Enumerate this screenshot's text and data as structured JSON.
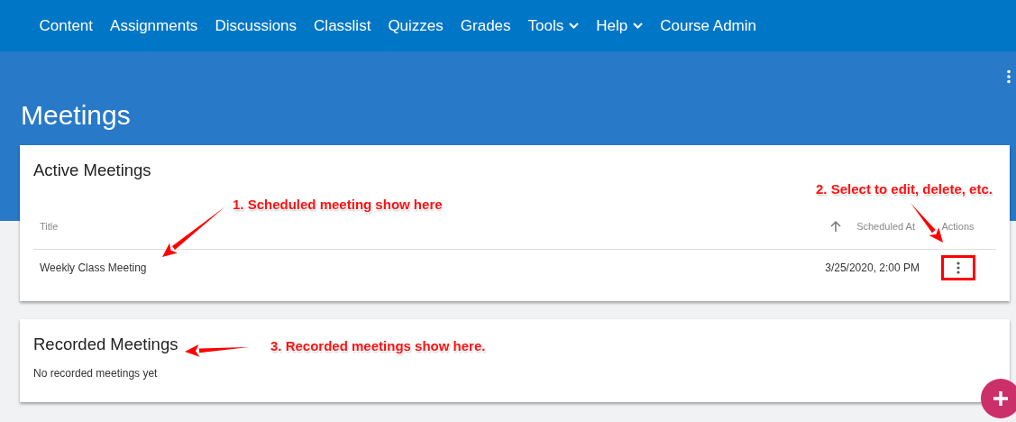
{
  "nav": [
    {
      "label": "Content",
      "has_menu": false
    },
    {
      "label": "Assignments",
      "has_menu": false
    },
    {
      "label": "Discussions",
      "has_menu": false
    },
    {
      "label": "Classlist",
      "has_menu": false
    },
    {
      "label": "Quizzes",
      "has_menu": false
    },
    {
      "label": "Grades",
      "has_menu": false
    },
    {
      "label": "Tools",
      "has_menu": true
    },
    {
      "label": "Help",
      "has_menu": true
    },
    {
      "label": "Course Admin",
      "has_menu": false
    }
  ],
  "page_title": "Meetings",
  "active_meetings": {
    "title": "Active Meetings",
    "columns": [
      {
        "label": "Title",
        "sorted": false
      },
      {
        "label": "Scheduled At",
        "sorted": true
      },
      {
        "label": "Actions",
        "sorted": false
      }
    ],
    "rows": [
      {
        "title": "Weekly Class Meeting",
        "scheduled_at": "3/25/2020, 2:00 PM",
        "highlighted": true
      }
    ]
  },
  "recorded_meetings": {
    "title": "Recorded Meetings",
    "empty_message": "No recorded meetings yet"
  },
  "annotations": [
    "1. Scheduled meeting show here",
    "2. Select to edit, delete, etc.",
    "3. Recorded meetings show here."
  ]
}
